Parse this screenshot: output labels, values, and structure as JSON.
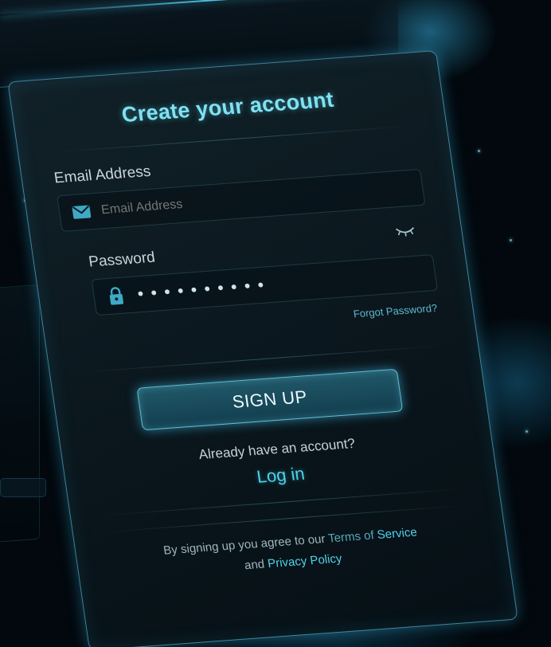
{
  "form": {
    "title": "Create your account",
    "email": {
      "label": "Email Address",
      "placeholder": "Email Address",
      "value": ""
    },
    "password": {
      "label": "Password",
      "masked_value": "••••••••••"
    },
    "forgot_label": "Forgot Password?",
    "signup_label": "SIGN UP",
    "already_text": "Already have an account?",
    "login_label": "Log in",
    "terms": {
      "prefix": "By signing up you agree to our",
      "terms_of": "Terms of",
      "service": "Service",
      "and": "and",
      "privacy": "Privacy Policy"
    }
  },
  "icons": {
    "email": "envelope-icon",
    "password": "lock-icon",
    "visibility": "eye-closed-icon"
  },
  "colors": {
    "accent": "#4ed2ea",
    "title": "#7fe2f2",
    "background": "#02080d"
  }
}
